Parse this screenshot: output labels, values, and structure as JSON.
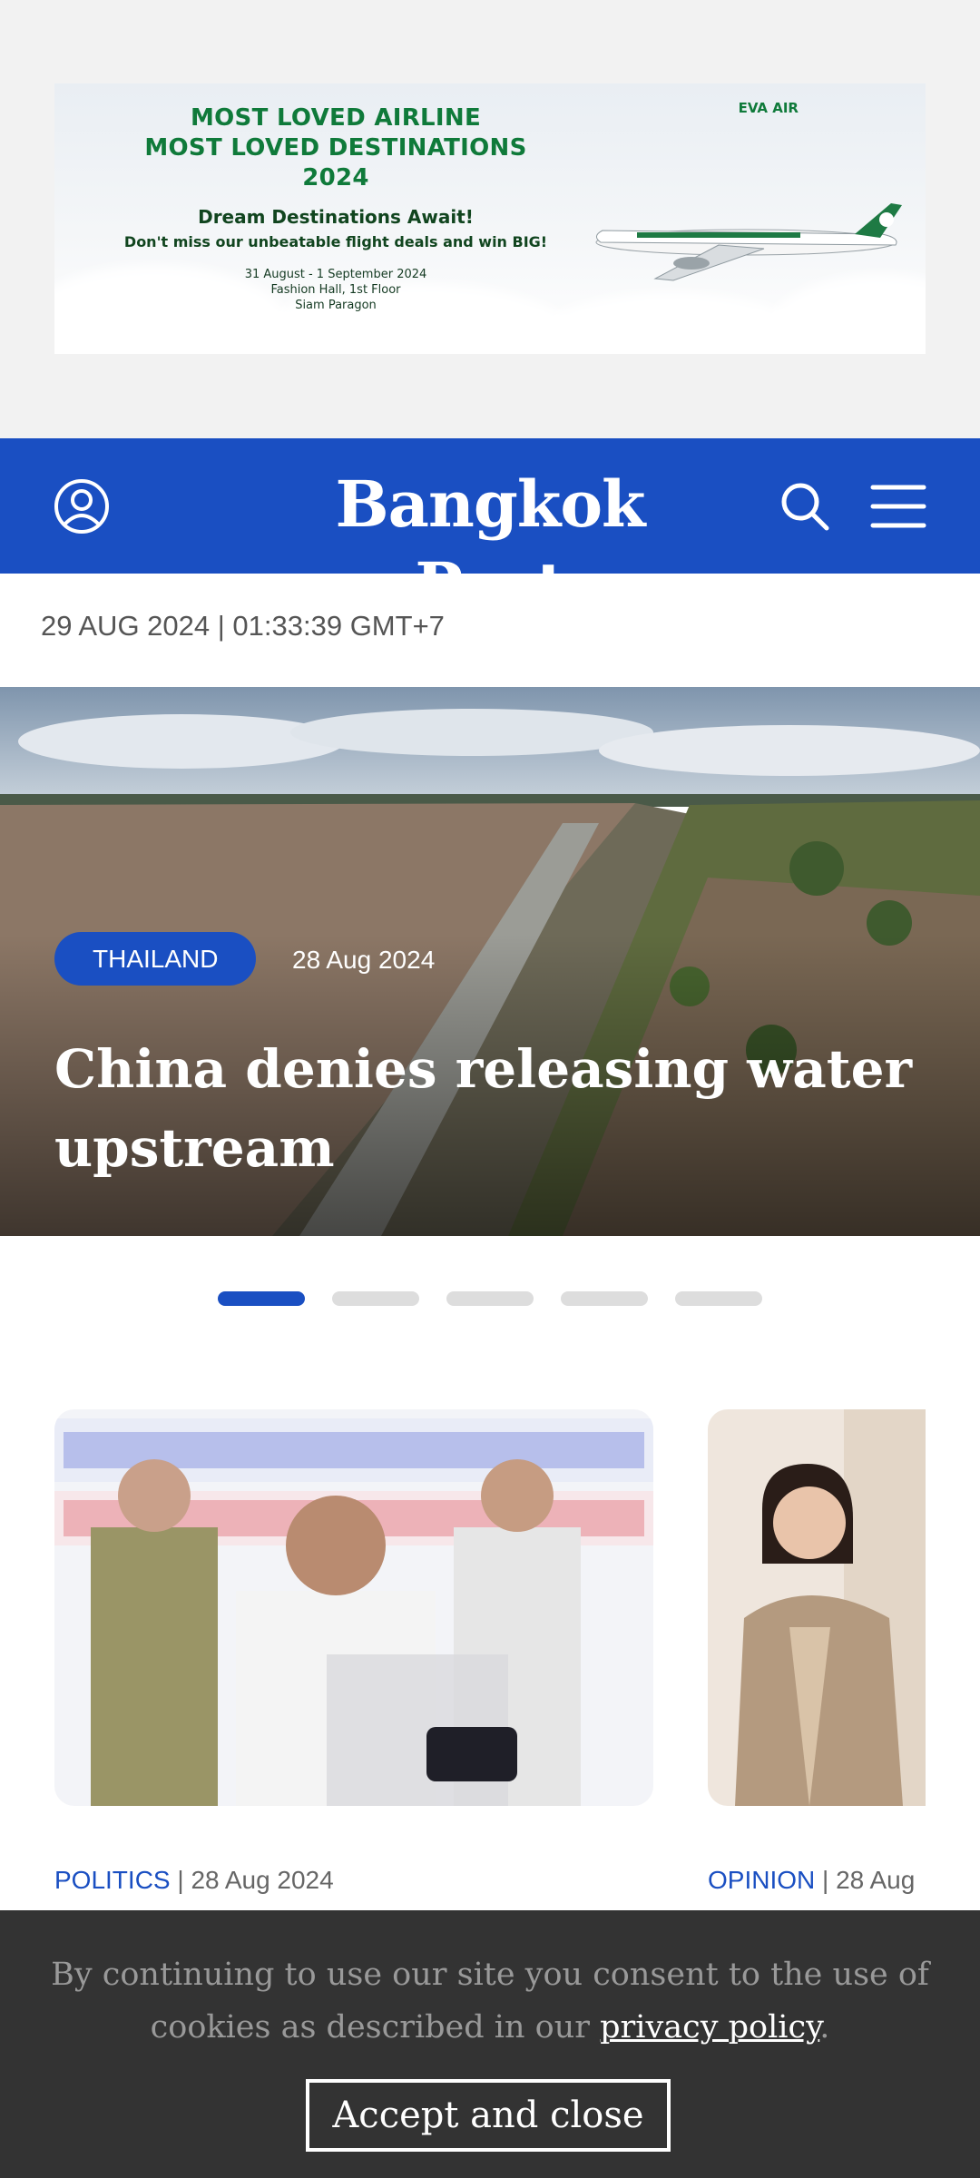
{
  "ad": {
    "line1": "MOST LOVED AIRLINE",
    "line2": "MOST LOVED DESTINATIONS",
    "line3": "2024",
    "headline": "Dream Destinations Await!",
    "subline": "Don't miss our unbeatable flight deals and win BIG!",
    "dates": "31 August - 1 September 2024",
    "venue1": "Fashion Hall, 1st Floor",
    "venue2": "Siam Paragon",
    "brand": "EVA AIR",
    "icon": "airplane-icon"
  },
  "header": {
    "logo": "Bangkok Post",
    "bg_color": "#1a4fc2",
    "account_icon": "user-icon",
    "search_icon": "search-icon",
    "menu_icon": "hamburger-menu-icon"
  },
  "datetime": "29 AUG 2024 | 01:33:39 GMT+7",
  "hero": {
    "category": "THAILAND",
    "date": "28 Aug 2024",
    "title": "China denies releasing water upstream"
  },
  "carousel": {
    "total": 5,
    "active": 1
  },
  "cards": [
    {
      "category": "POLITICS",
      "date": "28 Aug 2024"
    },
    {
      "category": "OPINION",
      "date": "28 Aug"
    }
  ],
  "cookie": {
    "text": "By continuing to use our site you consent to the use of cookies as described in our",
    "link": "privacy policy",
    "period": ".",
    "button": "Accept and close"
  }
}
